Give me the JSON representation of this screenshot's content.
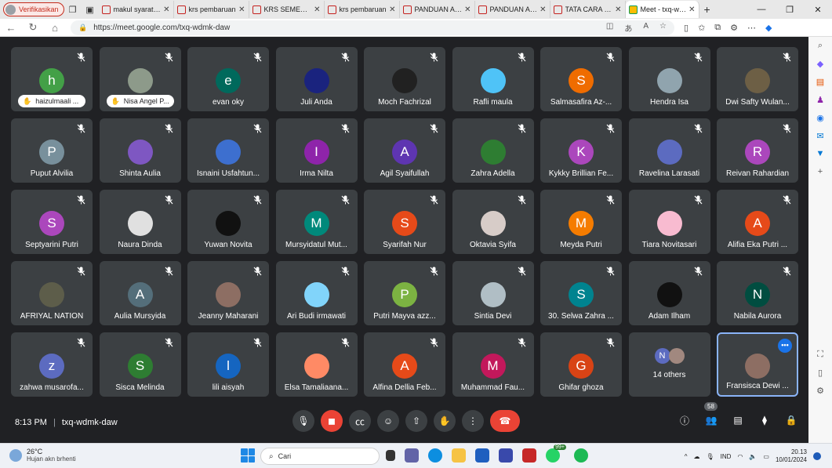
{
  "browser": {
    "profile_label": "Verifikasikan",
    "tabs": [
      {
        "label": "makul syarat KRS"
      },
      {
        "label": "krs pembaruan"
      },
      {
        "label": "KRS SEMESTER"
      },
      {
        "label": "krs pembaruan"
      },
      {
        "label": "PANDUAN AKADEMIK"
      },
      {
        "label": "PANDUAN AKADEMIK"
      },
      {
        "label": "TATA CARA ISI KRS"
      },
      {
        "label": "Meet - txq-wdmk-daw",
        "active": true
      }
    ],
    "url": "https://meet.google.com/txq-wdmk-daw"
  },
  "participants": [
    {
      "name": "haizulmaali ...",
      "initial": "h",
      "color": "#43a047",
      "hand": true
    },
    {
      "name": "Nisa Angel P...",
      "initial": "",
      "color": "#8d9a8a",
      "hand": true,
      "photo": true
    },
    {
      "name": "evan oky",
      "initial": "e",
      "color": "#00695c"
    },
    {
      "name": "Juli Anda",
      "initial": "",
      "color": "#1a237e",
      "photo": true
    },
    {
      "name": "Moch Fachrizal",
      "initial": "",
      "color": "#212121",
      "photo": true
    },
    {
      "name": "Rafli maula",
      "initial": "",
      "color": "#4fc3f7",
      "photo": true
    },
    {
      "name": "Salmasafira Az-...",
      "initial": "S",
      "color": "#ef6c00"
    },
    {
      "name": "Hendra Isa",
      "initial": "",
      "color": "#90a4ae",
      "photo": true
    },
    {
      "name": "Dwi Safty Wulan...",
      "initial": "",
      "color": "#6d5f45",
      "photo": true
    },
    {
      "name": "Puput Alvilia",
      "initial": "P",
      "color": "#78909c"
    },
    {
      "name": "Shinta Aulia",
      "initial": "",
      "color": "#7e57c2",
      "photo": true
    },
    {
      "name": "Isnaini Usfahtun...",
      "initial": "",
      "color": "#3d6fcf",
      "photo": true
    },
    {
      "name": "Irma Nilta",
      "initial": "I",
      "color": "#8e24aa"
    },
    {
      "name": "Agil Syaifullah",
      "initial": "A",
      "color": "#5e35b1"
    },
    {
      "name": "Zahra Adella",
      "initial": "",
      "color": "#2e7d32",
      "photo": true
    },
    {
      "name": "Kykky Brillian Fe...",
      "initial": "K",
      "color": "#ab47bc"
    },
    {
      "name": "Ravelina Larasati",
      "initial": "",
      "color": "#5c6bc0",
      "photo": true
    },
    {
      "name": "Reivan Rahardian",
      "initial": "R",
      "color": "#ab47bc"
    },
    {
      "name": "Septyarini Putri",
      "initial": "S",
      "color": "#ab47bc"
    },
    {
      "name": "Naura Dinda",
      "initial": "",
      "color": "#e0e0e0",
      "photo": true
    },
    {
      "name": "Yuwan Novita",
      "initial": "",
      "color": "#111111",
      "photo": true
    },
    {
      "name": "Mursyidatul Mut...",
      "initial": "M",
      "color": "#00897b"
    },
    {
      "name": "Syarifah Nur",
      "initial": "S",
      "color": "#e64a19"
    },
    {
      "name": "Oktavia Syifa",
      "initial": "",
      "color": "#d7ccc8",
      "photo": true
    },
    {
      "name": "Meyda Putri",
      "initial": "M",
      "color": "#f57c00"
    },
    {
      "name": "Tiara Novitasari",
      "initial": "",
      "color": "#f8bbd0",
      "photo": true
    },
    {
      "name": "Alifia Eka Putri ...",
      "initial": "A",
      "color": "#e64a19"
    },
    {
      "name": "AFRIYAL NATION",
      "initial": "",
      "color": "#5d5d4a",
      "photo": true
    },
    {
      "name": "Aulia Mursyida",
      "initial": "A",
      "color": "#546e7a"
    },
    {
      "name": "Jeanny Maharani",
      "initial": "",
      "color": "#8d6e63",
      "photo": true
    },
    {
      "name": "Ari Budi irmawati",
      "initial": "",
      "color": "#81d4fa",
      "photo": true
    },
    {
      "name": "Putri Mayva azz...",
      "initial": "P",
      "color": "#7cb342"
    },
    {
      "name": "Sintia Devi",
      "initial": "",
      "color": "#b0bec5",
      "photo": true
    },
    {
      "name": "30. Selwa Zahra ...",
      "initial": "S",
      "color": "#00838f"
    },
    {
      "name": "Adam Ilham",
      "initial": "",
      "color": "#111111",
      "photo": true
    },
    {
      "name": "Nabila Aurora",
      "initial": "N",
      "color": "#004d40"
    },
    {
      "name": "zahwa musarofa...",
      "initial": "z",
      "color": "#5c6bc0"
    },
    {
      "name": "Sisca Melinda",
      "initial": "S",
      "color": "#2e7d32"
    },
    {
      "name": "lili aisyah",
      "initial": "l",
      "color": "#1565c0"
    },
    {
      "name": "Elsa Tamaliaana...",
      "initial": "",
      "color": "#ff8a65",
      "photo": true
    },
    {
      "name": "Alfina Dellia Feb...",
      "initial": "A",
      "color": "#e64a19"
    },
    {
      "name": "Muhammad Fau...",
      "initial": "M",
      "color": "#c2185b"
    },
    {
      "name": "Ghifar ghoza",
      "initial": "G",
      "color": "#d84315"
    }
  ],
  "others_tile": {
    "label": "14 others",
    "initial_a": "N"
  },
  "active_tile": {
    "name": "Fransisca Dewi ...",
    "more": "•••"
  },
  "meeting": {
    "time": "8:13 PM",
    "separator": "|",
    "code": "txq-wdmk-daw",
    "people_count": "58"
  },
  "taskbar": {
    "temp": "26°C",
    "weather": "Hujan akn brhenti",
    "search_label": "Cari",
    "whatsapp_badge": "99+",
    "lang": "IND",
    "time": "20.13",
    "date": "10/01/2024"
  }
}
